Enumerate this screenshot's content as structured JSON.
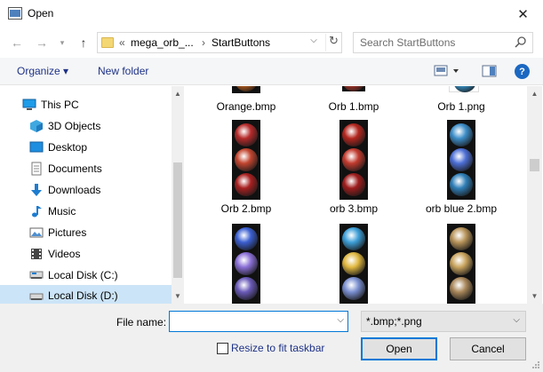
{
  "window": {
    "title": "Open"
  },
  "address": {
    "crumb_prefix": "«",
    "crumb_1": "mega_orb_...",
    "crumb_sep": "›",
    "crumb_2": "StartButtons",
    "search_placeholder": "Search StartButtons"
  },
  "toolbar": {
    "organize": "Organize ▾",
    "new_folder": "New folder",
    "help": "?"
  },
  "nav": {
    "items": [
      {
        "label": "This PC",
        "icon": "pc-icon"
      },
      {
        "label": "3D Objects",
        "icon": "3d-objects-icon"
      },
      {
        "label": "Desktop",
        "icon": "desktop-icon"
      },
      {
        "label": "Documents",
        "icon": "documents-icon"
      },
      {
        "label": "Downloads",
        "icon": "downloads-icon"
      },
      {
        "label": "Music",
        "icon": "music-icon"
      },
      {
        "label": "Pictures",
        "icon": "pictures-icon"
      },
      {
        "label": "Videos",
        "icon": "videos-icon"
      },
      {
        "label": "Local Disk (C:)",
        "icon": "drive-icon"
      },
      {
        "label": "Local Disk (D:)",
        "icon": "drive-icon"
      }
    ]
  },
  "files": [
    {
      "name": "Orange.bmp",
      "colors": [
        "#d2691e"
      ]
    },
    {
      "name": "Orb 1.bmp",
      "colors": [
        "#c0392b"
      ]
    },
    {
      "name": "Orb 1.png",
      "colors": [
        "#3a9fd8"
      ]
    },
    {
      "name": "Orb 2.bmp",
      "colors": [
        "#b52a2a",
        "#c2452f",
        "#a82020"
      ]
    },
    {
      "name": "orb 3.bmp",
      "colors": [
        "#b3261e",
        "#c23a2e",
        "#9e1c1c"
      ]
    },
    {
      "name": "orb blue 2.bmp",
      "colors": [
        "#3d8ec9",
        "#4d6fd6",
        "#2f7fb8"
      ]
    },
    {
      "name": "",
      "colors": [
        "#3b5fd1",
        "#8a6fd6",
        "#6a5ab8"
      ]
    },
    {
      "name": "",
      "colors": [
        "#3d9fd8",
        "#e0b840",
        "#7a8fd0"
      ]
    },
    {
      "name": "",
      "colors": [
        "#b8945a",
        "#c9a45e",
        "#a9875a"
      ]
    }
  ],
  "bottom": {
    "file_name_label": "File name:",
    "file_name_value": "",
    "filter_value": "*.bmp;*.png",
    "resize_label": "Resize to fit taskbar",
    "open_label": "Open",
    "cancel_label": "Cancel"
  }
}
